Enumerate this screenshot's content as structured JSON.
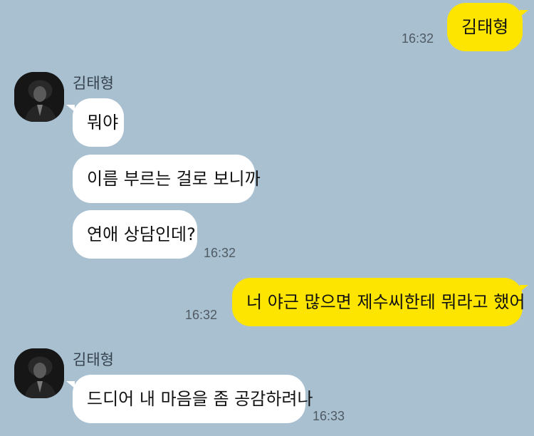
{
  "contact": {
    "name": "김태형"
  },
  "messages": [
    {
      "text": "김태형",
      "time": "16:32"
    },
    {
      "text": "뭐야"
    },
    {
      "text": "이름 부르는 걸로 보니까"
    },
    {
      "text": "연애 상담인데?",
      "time": "16:32"
    },
    {
      "text": "너 야근 많으면 제수씨한테 뭐라고 했어",
      "time": "16:32"
    },
    {
      "text": "드디어 내 마음을 좀 공감하려나",
      "time": "16:33"
    }
  ],
  "colors": {
    "background": "#a9c0d1",
    "incoming_bubble": "#ffffff",
    "outgoing_bubble": "#fee500"
  }
}
